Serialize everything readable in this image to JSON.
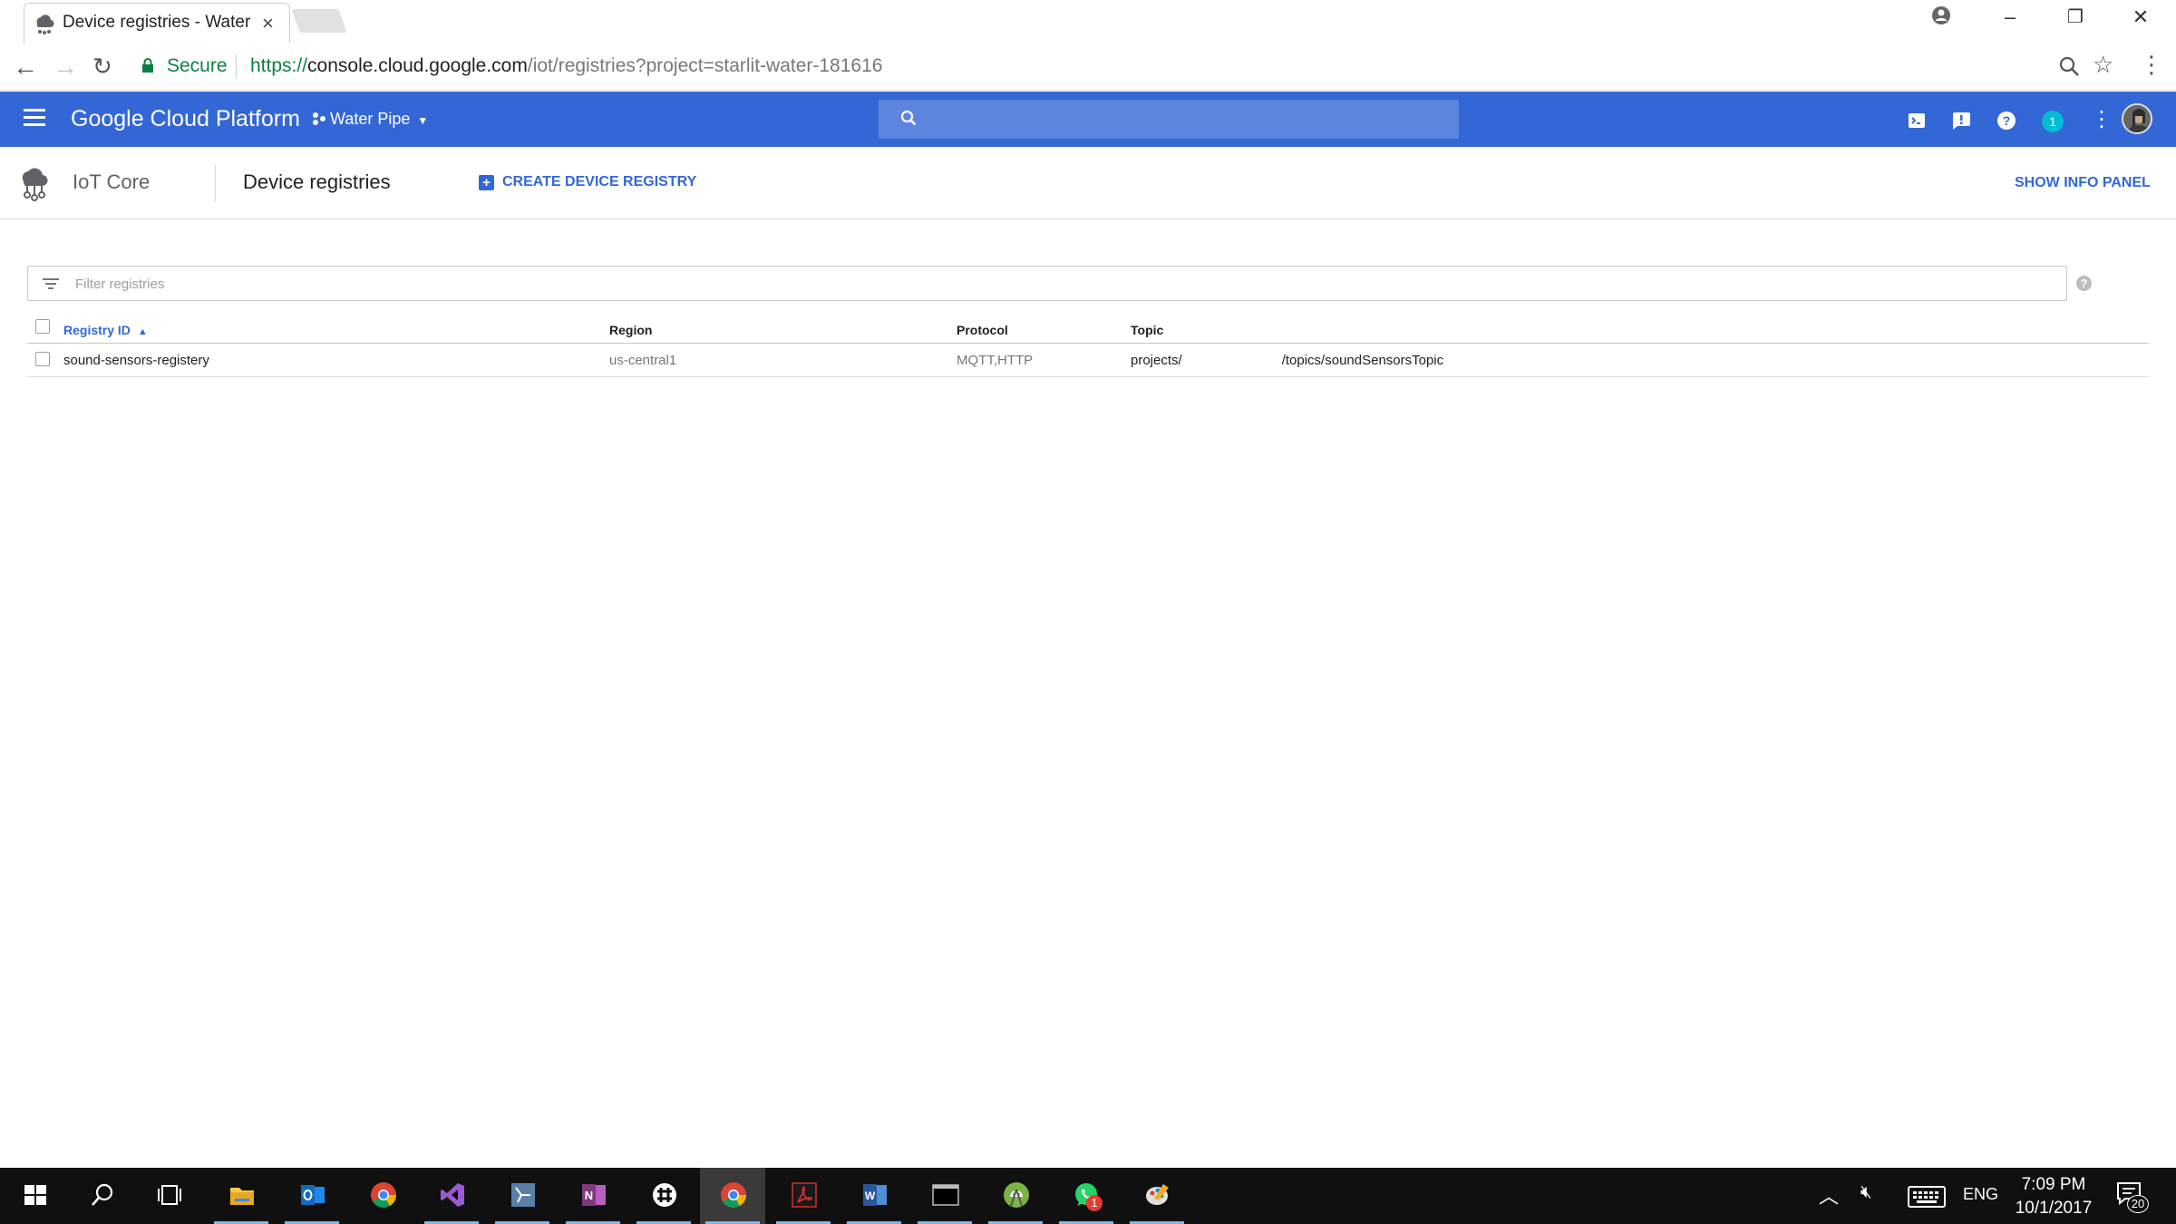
{
  "browser": {
    "tab_title": "Device registries - Water",
    "secure_label": "Secure",
    "url_scheme": "https://",
    "url_domain": "console.cloud.google.com",
    "url_path": "/iot/registries?project=starlit-water-181616"
  },
  "gcp_header": {
    "platform_title": "Google Cloud Platform",
    "project_name": "Water Pipe",
    "notification_count": "1",
    "accent_color": "#3367d6"
  },
  "page": {
    "product_name": "IoT Core",
    "title": "Device registries",
    "create_button": "CREATE DEVICE REGISTRY",
    "info_panel_button": "SHOW INFO PANEL"
  },
  "filter": {
    "placeholder": "Filter registries"
  },
  "table": {
    "headers": {
      "registry_id": "Registry ID",
      "region": "Region",
      "protocol": "Protocol",
      "topic": "Topic"
    },
    "sort_indicator": "^",
    "rows": [
      {
        "registry_id": "sound-sensors-registery",
        "region": "us-central1",
        "protocol": "MQTT,HTTP",
        "topic_prefix": "projects/",
        "topic_suffix": "/topics/soundSensorsTopic"
      }
    ]
  },
  "taskbar": {
    "time": "7:09 PM",
    "date": "10/1/2017",
    "language": "ENG",
    "notifications": "20",
    "whatsapp_badge": "1",
    "apps": [
      "start-icon",
      "search-icon",
      "task-view-icon",
      "file-explorer-icon",
      "outlook-icon",
      "chrome-icon",
      "visual-studio-icon",
      "sql-server-icon",
      "onenote-icon",
      "slack-icon",
      "chrome-icon",
      "acrobat-icon",
      "word-icon",
      "terminal-icon",
      "android-studio-icon",
      "whatsapp-icon",
      "paint-icon"
    ]
  }
}
